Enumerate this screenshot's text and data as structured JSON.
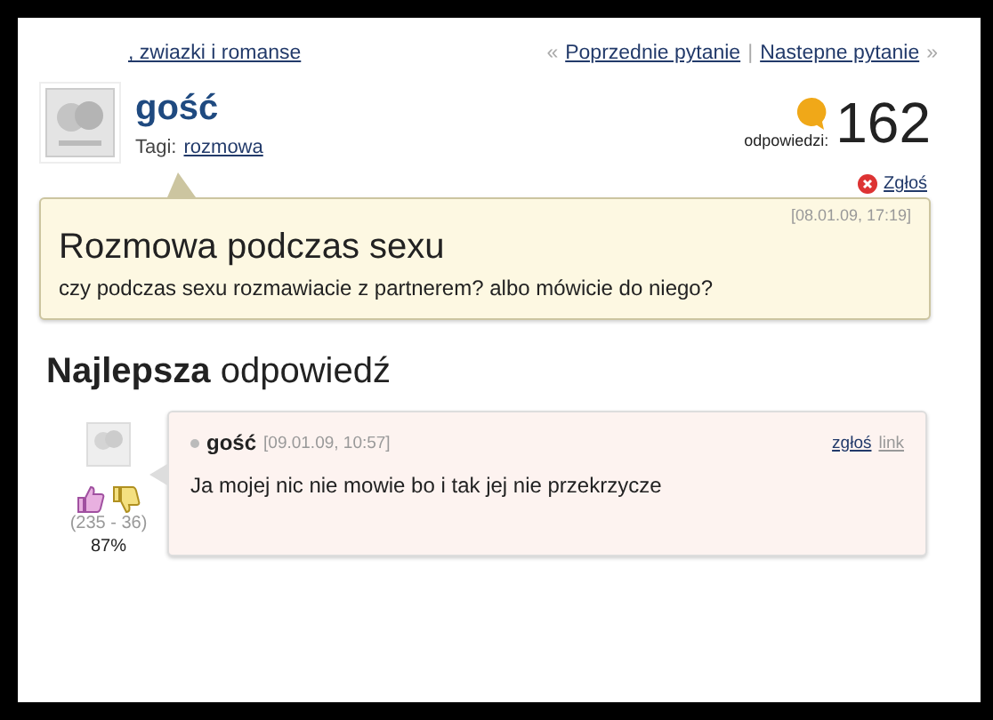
{
  "breadcrumb": {
    "link": ", zwiazki i romanse"
  },
  "nav": {
    "prev_mark": "«",
    "prev": "Poprzednie pytanie",
    "separator": "|",
    "next": "Nastepne pytanie",
    "next_mark": "»"
  },
  "question": {
    "author": "gość",
    "tags_label": "Tagi:",
    "tags": [
      "rozmowa"
    ],
    "answers_label": "odpowiedzi:",
    "answers_count": "162",
    "report": "Zgłoś",
    "date": "[08.01.09, 17:19]",
    "title": "Rozmowa podczas sexu",
    "body": "czy podczas sexu rozmawiacie z partnerem? albo mówicie do niego?"
  },
  "best_answer": {
    "heading_bold": "Najlepsza",
    "heading_rest": "odpowiedź",
    "author": "gość",
    "date": "[09.01.09, 10:57]",
    "report": "zgłoś",
    "link": "link",
    "text": "Ja mojej nic nie mowie bo i tak jej nie przekrzycze",
    "votes": "(235 - 36)",
    "percent": "87%"
  }
}
